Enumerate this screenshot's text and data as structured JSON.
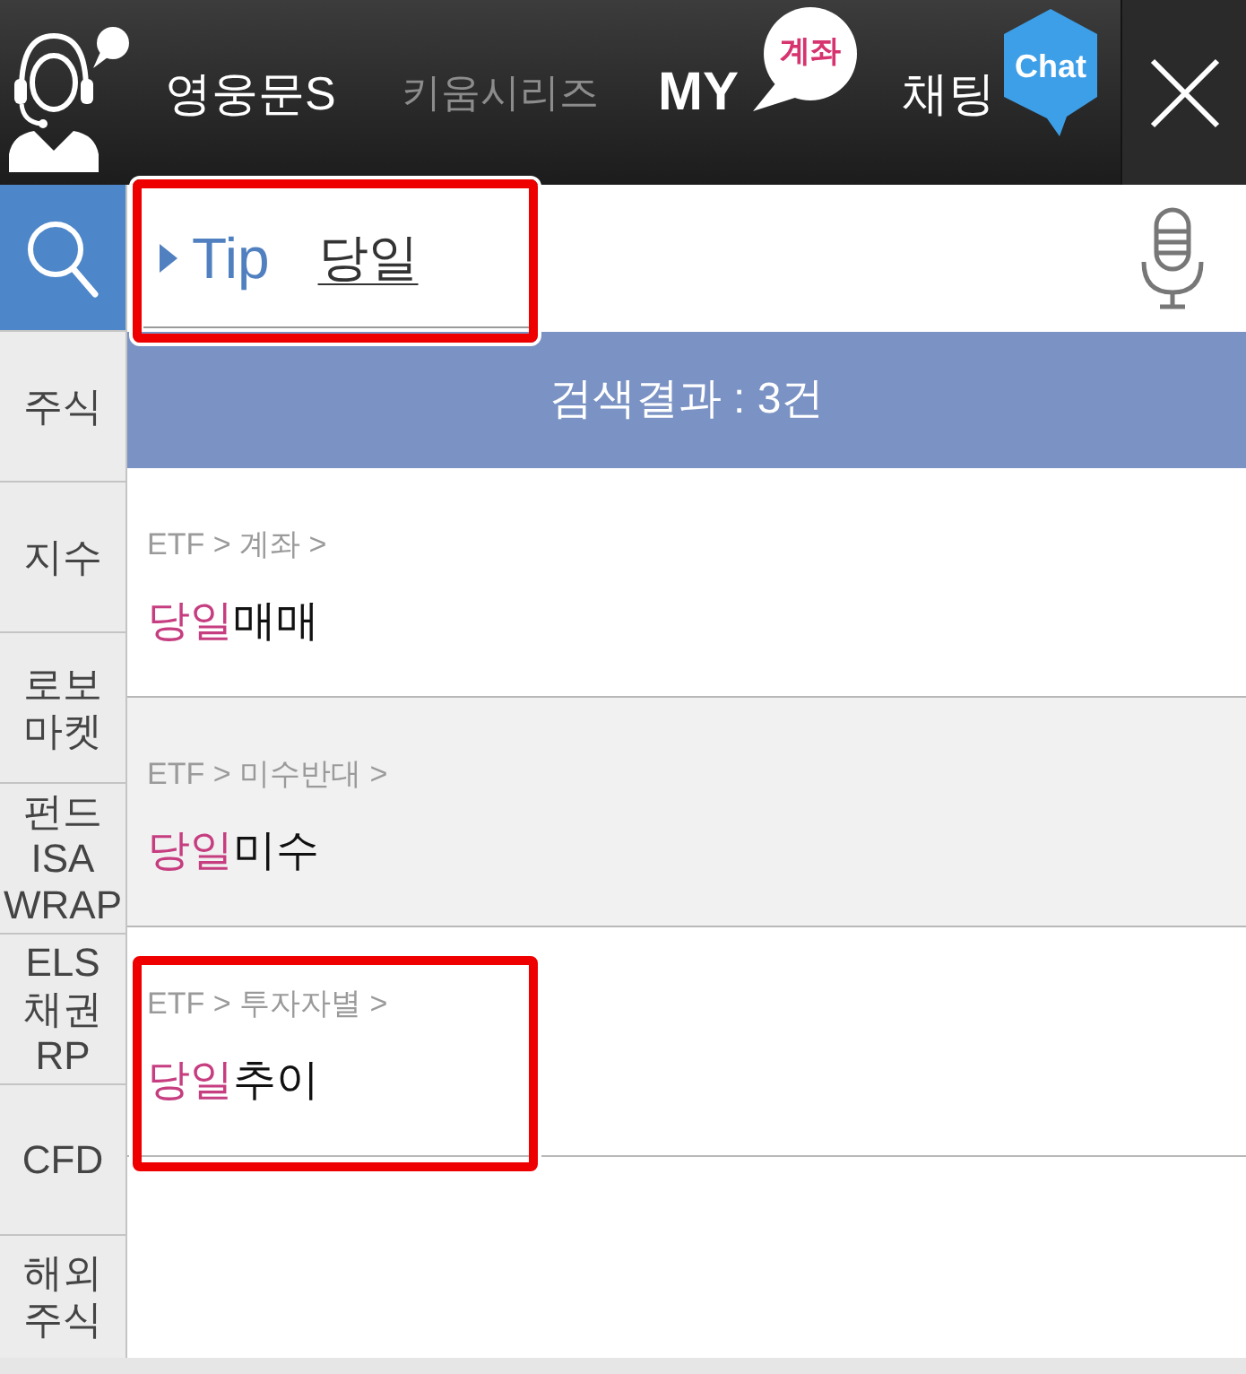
{
  "header": {
    "tabs": [
      {
        "label": "영웅문S",
        "selected": true
      },
      {
        "label": "키움시리즈",
        "selected": false
      }
    ],
    "my_account": {
      "label": "MY",
      "badge": "계좌"
    },
    "chat": {
      "label": "채팅",
      "badge": "Chat"
    }
  },
  "sidebar": {
    "items": [
      {
        "kind": "search",
        "selected": true
      },
      {
        "kind": "text",
        "label": "주식",
        "selected": false
      },
      {
        "kind": "text",
        "label": "지수",
        "selected": false
      },
      {
        "kind": "text",
        "label": "로보 마켓",
        "selected": false
      },
      {
        "kind": "text",
        "label": "펀드 ISA WRAP",
        "selected": false
      },
      {
        "kind": "text",
        "label": "ELS 채권 RP",
        "selected": false
      },
      {
        "kind": "text",
        "label": "CFD",
        "selected": false
      },
      {
        "kind": "text",
        "label": "해외 주식",
        "selected": false
      }
    ]
  },
  "search": {
    "tip": "Tip",
    "value": "당일",
    "highlighted": true
  },
  "results": {
    "header": "검색결과 : 3건",
    "items": [
      {
        "path": "ETF > 계좌 >",
        "match": "당일",
        "rest": "매매",
        "highlighted": false
      },
      {
        "path": "ETF > 미수반대 >",
        "match": "당일",
        "rest": "미수",
        "highlighted": false
      },
      {
        "path": "ETF > 투자자별 >",
        "match": "당일",
        "rest": "추이",
        "highlighted": true
      }
    ]
  }
}
